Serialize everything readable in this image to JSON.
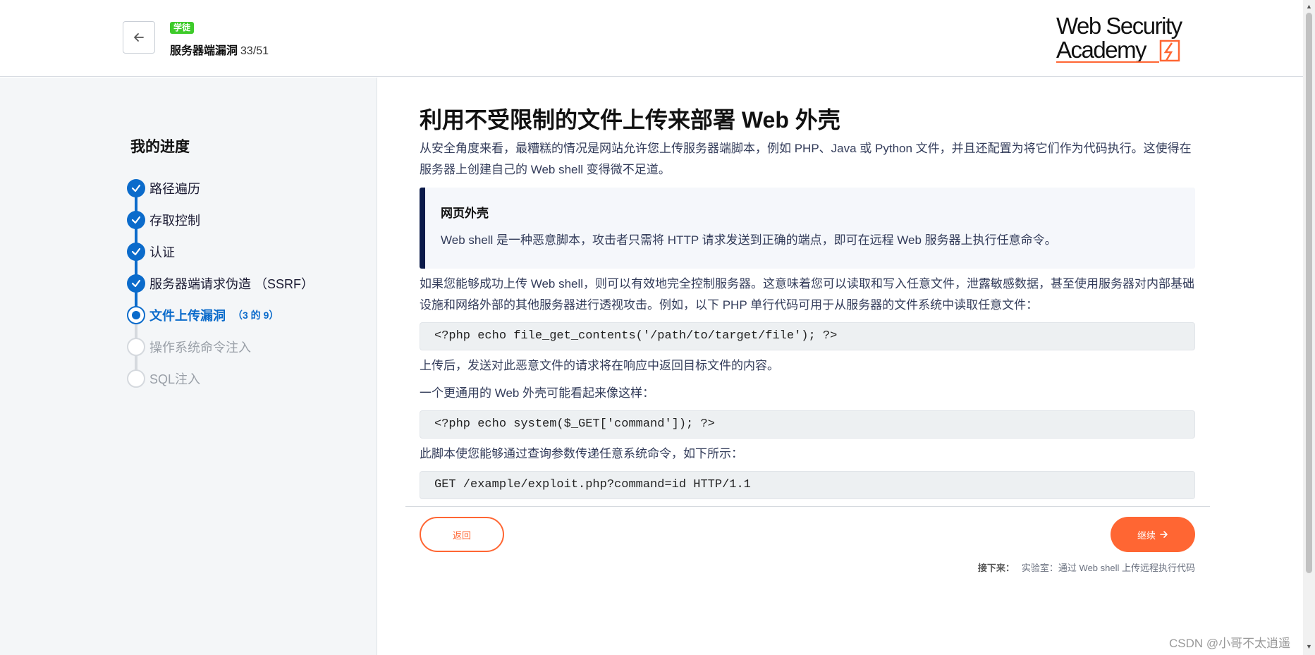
{
  "header": {
    "level_badge": "学徒",
    "course_title": "服务器端漏洞",
    "course_count": "33/51",
    "logo": {
      "line1": "Web Security",
      "line2": "Academy"
    }
  },
  "sidebar": {
    "title": "我的进度",
    "steps": [
      {
        "label": "路径遍历",
        "state": "done"
      },
      {
        "label": "存取控制",
        "state": "done"
      },
      {
        "label": "认证",
        "state": "done"
      },
      {
        "label": "服务器端请求伪造 （SSRF）",
        "state": "done"
      },
      {
        "label": "文件上传漏洞",
        "state": "current",
        "sub": "（3 的 9）"
      },
      {
        "label": "操作系统命令注入",
        "state": "todo"
      },
      {
        "label": "SQL注入",
        "state": "todo"
      }
    ]
  },
  "main": {
    "heading": "利用不受限制的文件上传来部署 Web 外壳",
    "intro": "从安全角度来看，最糟糕的情况是网站允许您上传服务器端脚本，例如 PHP、Java 或 Python 文件，并且还配置为将它们作为代码执行。这使得在服务器上创建自己的 Web shell 变得微不足道。",
    "note": {
      "title": "网页外壳",
      "body": "Web shell 是一种恶意脚本，攻击者只需将 HTTP 请求发送到正确的端点，即可在远程 Web 服务器上执行任意命令。"
    },
    "para2": "如果您能够成功上传 Web shell，则可以有效地完全控制服务器。这意味着您可以读取和写入任意文件，泄露敏感数据，甚至使用服务器对内部基础设施和网络外部的其他服务器进行透视攻击。例如，以下 PHP 单行代码可用于从服务器的文件系统中读取任意文件：",
    "code1": "<?php echo file_get_contents('/path/to/target/file'); ?>",
    "para3": "上传后，发送对此恶意文件的请求将在响应中返回目标文件的内容。",
    "para4": "一个更通用的 Web 外壳可能看起来像这样：",
    "code2": "<?php echo system($_GET['command']); ?>",
    "para5": "此脚本使您能够通过查询参数传递任意系统命令，如下所示：",
    "code3": "GET /example/exploit.php?command=id HTTP/1.1"
  },
  "footer": {
    "back_label": "返回",
    "next_label": "继续",
    "next_prefix": "接下来：",
    "next_text": "实验室：通过 Web shell 上传远程执行代码"
  },
  "watermark": "CSDN @小哥不太逍遥",
  "colors": {
    "accent": "#0b6bcb",
    "orange": "#ff6633",
    "badge": "#3ecb2a"
  }
}
